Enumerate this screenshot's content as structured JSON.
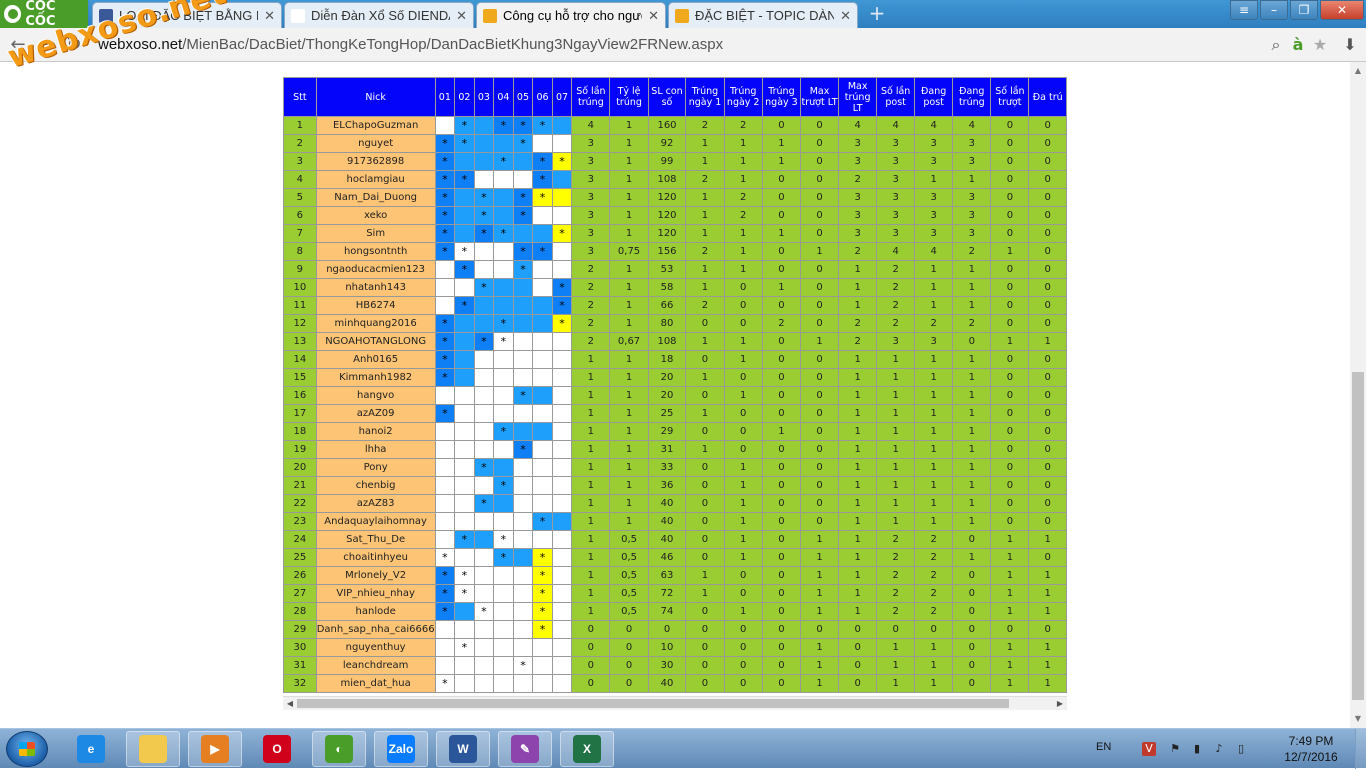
{
  "browser": {
    "brand": "CỐC CỐC",
    "tabs": [
      {
        "title": "LOẠI ĐẶC BIỆT BẰNG NGÀ",
        "icon": "facebook-icon",
        "color": "#3b5998"
      },
      {
        "title": "Diễn Đàn Xổ Số DIENDAN",
        "icon": "page-icon",
        "color": "#ffffff"
      },
      {
        "title": "Công cụ hỗ trợ cho người",
        "icon": "xs-icon",
        "color": "#f0a81c"
      },
      {
        "title": "ĐẶC BIỆT - TOPIC DÀN Đ",
        "icon": "xs-icon",
        "color": "#f0a81c"
      }
    ],
    "active_tab": 2,
    "url_host": "webxoso.net",
    "url_path": "/MienBac/DacBiet/ThongKeTongHop/DanDacBietKhung3NgayView2FRNew.aspx",
    "watermark": "webxoso.net"
  },
  "table": {
    "headers": [
      "Stt",
      "Nick",
      "01",
      "02",
      "03",
      "04",
      "05",
      "06",
      "07",
      "Số lần trúng",
      "Tỷ lệ trúng",
      "SL con số",
      "Trúng ngày 1",
      "Trúng ngày 2",
      "Trúng ngày 3",
      "Max trượt LT",
      "Max trúng LT",
      "Số lần post",
      "Đang post",
      "Đang trúng",
      "Số lần trượt",
      "Đa trú"
    ],
    "rows": [
      {
        "stt": "1",
        "nick": "ELChapoGuzman",
        "d": "w:,M:*,M:,L:*,L:*,M:*,M:",
        "s": [
          "4",
          "1",
          "160",
          "2",
          "2",
          "0",
          "0",
          "4",
          "4",
          "4",
          "4",
          "0",
          "0"
        ]
      },
      {
        "stt": "2",
        "nick": "nguyet",
        "d": "L:*,M:*,M:,M:,M:*,w:,w:",
        "s": [
          "3",
          "1",
          "92",
          "1",
          "1",
          "1",
          "0",
          "3",
          "3",
          "3",
          "3",
          "0",
          "0"
        ]
      },
      {
        "stt": "3",
        "nick": "917362898",
        "d": "L:*,M:,M:,M:*,M:,L:*,Y:*",
        "s": [
          "3",
          "1",
          "99",
          "1",
          "1",
          "1",
          "0",
          "3",
          "3",
          "3",
          "3",
          "0",
          "0"
        ]
      },
      {
        "stt": "4",
        "nick": "hoclamgiau",
        "d": "L:*,L:*,w:,w:,w:,L:*,M:",
        "s": [
          "3",
          "1",
          "108",
          "2",
          "1",
          "0",
          "0",
          "2",
          "3",
          "1",
          "1",
          "0",
          "0"
        ]
      },
      {
        "stt": "5",
        "nick": "Nam_Dai_Duong",
        "d": "L:*,M:,M:*,M:,L:*,Y:*,Y:",
        "s": [
          "3",
          "1",
          "120",
          "1",
          "2",
          "0",
          "0",
          "3",
          "3",
          "3",
          "3",
          "0",
          "0"
        ]
      },
      {
        "stt": "6",
        "nick": "xeko",
        "d": "L:*,M:,M:*,M:,L:*,w:,w:",
        "s": [
          "3",
          "1",
          "120",
          "1",
          "2",
          "0",
          "0",
          "3",
          "3",
          "3",
          "3",
          "0",
          "0"
        ]
      },
      {
        "stt": "7",
        "nick": "Sim",
        "d": "L:*,M:,L:*,M:*,M:,M:,Y:*",
        "s": [
          "3",
          "1",
          "120",
          "1",
          "1",
          "1",
          "0",
          "3",
          "3",
          "3",
          "3",
          "0",
          "0"
        ]
      },
      {
        "stt": "8",
        "nick": "hongsontnth",
        "d": "L:*,w:*,w:,w:,L:*,L:*,w:",
        "s": [
          "3",
          "0,75",
          "156",
          "2",
          "1",
          "0",
          "1",
          "2",
          "4",
          "4",
          "2",
          "1",
          "0"
        ]
      },
      {
        "stt": "9",
        "nick": "ngaoducacmien123",
        "d": "w:,L:*,w:,w:,M:*,w:,w:",
        "s": [
          "2",
          "1",
          "53",
          "1",
          "1",
          "0",
          "0",
          "1",
          "2",
          "1",
          "1",
          "0",
          "0"
        ]
      },
      {
        "stt": "10",
        "nick": "nhatanh143",
        "d": "w:,w:,M:*,M:,M:,w:,L:*",
        "s": [
          "2",
          "1",
          "58",
          "1",
          "0",
          "1",
          "0",
          "1",
          "2",
          "1",
          "1",
          "0",
          "0"
        ]
      },
      {
        "stt": "11",
        "nick": "HB6274",
        "d": "w:,L:*,M:,M:,M:,M:,L:*",
        "s": [
          "2",
          "1",
          "66",
          "2",
          "0",
          "0",
          "0",
          "1",
          "2",
          "1",
          "1",
          "0",
          "0"
        ]
      },
      {
        "stt": "12",
        "nick": "minhquang2016",
        "d": "L:*,M:,M:,M:*,M:,M:,Y:*",
        "s": [
          "2",
          "1",
          "80",
          "0",
          "0",
          "2",
          "0",
          "2",
          "2",
          "2",
          "2",
          "0",
          "0"
        ]
      },
      {
        "stt": "13",
        "nick": "NGOAHOTANGLONG",
        "d": "L:*,M:,L:*,w:*,w:,w:,w:",
        "s": [
          "2",
          "0,67",
          "108",
          "1",
          "1",
          "0",
          "1",
          "2",
          "3",
          "3",
          "0",
          "1",
          "1"
        ]
      },
      {
        "stt": "14",
        "nick": "Anh0165",
        "d": "L:*,M:,w:,w:,w:,w:,w:",
        "s": [
          "1",
          "1",
          "18",
          "0",
          "1",
          "0",
          "0",
          "1",
          "1",
          "1",
          "1",
          "0",
          "0"
        ]
      },
      {
        "stt": "15",
        "nick": "Kimmanh1982",
        "d": "L:*,M:,w:,w:,w:,w:,w:",
        "s": [
          "1",
          "1",
          "20",
          "1",
          "0",
          "0",
          "0",
          "1",
          "1",
          "1",
          "1",
          "0",
          "0"
        ]
      },
      {
        "stt": "16",
        "nick": "hangvo",
        "d": "w:,w:,w:,w:,M:*,M:,w:",
        "s": [
          "1",
          "1",
          "20",
          "0",
          "1",
          "0",
          "0",
          "1",
          "1",
          "1",
          "1",
          "0",
          "0"
        ]
      },
      {
        "stt": "17",
        "nick": "azAZ09",
        "d": "L:*,w:,w:,w:,w:,w:,w:",
        "s": [
          "1",
          "1",
          "25",
          "1",
          "0",
          "0",
          "0",
          "1",
          "1",
          "1",
          "1",
          "0",
          "0"
        ]
      },
      {
        "stt": "18",
        "nick": "hanoi2",
        "d": "w:,w:,w:,M:*,M:,M:,w:",
        "s": [
          "1",
          "1",
          "29",
          "0",
          "0",
          "1",
          "0",
          "1",
          "1",
          "1",
          "1",
          "0",
          "0"
        ]
      },
      {
        "stt": "19",
        "nick": "lhha",
        "d": "w:,w:,w:,w:,L:*,w:,w:",
        "s": [
          "1",
          "1",
          "31",
          "1",
          "0",
          "0",
          "0",
          "1",
          "1",
          "1",
          "1",
          "0",
          "0"
        ]
      },
      {
        "stt": "20",
        "nick": "Pony",
        "d": "w:,w:,M:*,M:,w:,w:,w:",
        "s": [
          "1",
          "1",
          "33",
          "0",
          "1",
          "0",
          "0",
          "1",
          "1",
          "1",
          "1",
          "0",
          "0"
        ]
      },
      {
        "stt": "21",
        "nick": "chenbig",
        "d": "w:,w:,w:,M:*,w:,w:,w:",
        "s": [
          "1",
          "1",
          "36",
          "0",
          "1",
          "0",
          "0",
          "1",
          "1",
          "1",
          "1",
          "0",
          "0"
        ]
      },
      {
        "stt": "22",
        "nick": "azAZ83",
        "d": "w:,w:,M:*,M:,w:,w:,w:",
        "s": [
          "1",
          "1",
          "40",
          "0",
          "1",
          "0",
          "0",
          "1",
          "1",
          "1",
          "1",
          "0",
          "0"
        ]
      },
      {
        "stt": "23",
        "nick": "Andaquaylaihomnay",
        "d": "w:,w:,w:,w:,w:,M:*,M:",
        "s": [
          "1",
          "1",
          "40",
          "0",
          "1",
          "0",
          "0",
          "1",
          "1",
          "1",
          "1",
          "0",
          "0"
        ]
      },
      {
        "stt": "24",
        "nick": "Sat_Thu_De",
        "d": "w:,M:*,M:,w:*,w:,w:,w:",
        "s": [
          "1",
          "0,5",
          "40",
          "0",
          "1",
          "0",
          "1",
          "1",
          "2",
          "2",
          "0",
          "1",
          "1"
        ]
      },
      {
        "stt": "25",
        "nick": "choaitinhyeu",
        "d": "w:*,w:,w:,M:*,M:,Y:*,w:",
        "s": [
          "1",
          "0,5",
          "46",
          "0",
          "1",
          "0",
          "1",
          "1",
          "2",
          "2",
          "1",
          "1",
          "0"
        ]
      },
      {
        "stt": "26",
        "nick": "Mrlonely_V2",
        "d": "L:*,w:*,w:,w:,w:,Y:*,w:",
        "s": [
          "1",
          "0,5",
          "63",
          "1",
          "0",
          "0",
          "1",
          "1",
          "2",
          "2",
          "0",
          "1",
          "1"
        ]
      },
      {
        "stt": "27",
        "nick": "VIP_nhieu_nhay",
        "d": "L:*,w:*,w:,w:,w:,Y:*,w:",
        "s": [
          "1",
          "0,5",
          "72",
          "1",
          "0",
          "0",
          "1",
          "1",
          "2",
          "2",
          "0",
          "1",
          "1"
        ]
      },
      {
        "stt": "28",
        "nick": "hanlode",
        "d": "L:*,M:,w:*,w:,w:,Y:*,w:",
        "s": [
          "1",
          "0,5",
          "74",
          "0",
          "1",
          "0",
          "1",
          "1",
          "2",
          "2",
          "0",
          "1",
          "1"
        ]
      },
      {
        "stt": "29",
        "nick": "Danh_sap_nha_cai6666",
        "d": "w:,w:,w:,w:,w:,Y:*,w:",
        "s": [
          "0",
          "0",
          "0",
          "0",
          "0",
          "0",
          "0",
          "0",
          "0",
          "0",
          "0",
          "0",
          "0"
        ]
      },
      {
        "stt": "30",
        "nick": "nguyenthuy",
        "d": "w:,w:*,w:,w:,w:,w:,w:",
        "s": [
          "0",
          "0",
          "10",
          "0",
          "0",
          "0",
          "1",
          "0",
          "1",
          "1",
          "0",
          "1",
          "1"
        ]
      },
      {
        "stt": "31",
        "nick": "leanchdream",
        "d": "w:,w:,w:,w:,w:*,w:,w:",
        "s": [
          "0",
          "0",
          "30",
          "0",
          "0",
          "0",
          "1",
          "0",
          "1",
          "1",
          "0",
          "1",
          "1"
        ]
      },
      {
        "stt": "32",
        "nick": "mien_dat_hua",
        "d": "w:*,w:,w:,w:,w:,w:,w:",
        "s": [
          "0",
          "0",
          "40",
          "0",
          "0",
          "0",
          "1",
          "0",
          "1",
          "1",
          "0",
          "1",
          "1"
        ]
      }
    ]
  },
  "colors": {
    "header_bg": "#0404fb",
    "stt_bg": "#9acd32",
    "nick_bg": "#fcc474",
    "dark_blue": "#0e7ff5",
    "mid_blue": "#1f9ffc",
    "yellow": "#ffff00"
  },
  "taskbar": {
    "apps": [
      {
        "name": "internet-explorer-icon",
        "label": "e",
        "color": "#1e88e5",
        "open": false
      },
      {
        "name": "file-explorer-icon",
        "label": "",
        "color": "#f2c94c",
        "open": true
      },
      {
        "name": "media-player-icon",
        "label": "▶",
        "color": "#e67e22",
        "open": true
      },
      {
        "name": "opera-icon",
        "label": "O",
        "color": "#d0021b",
        "open": false
      },
      {
        "name": "coccoc-icon",
        "label": "◐",
        "color": "#4b9d2a",
        "open": true
      },
      {
        "name": "zalo-icon",
        "label": "Zalo",
        "color": "#0a7cff",
        "open": true
      },
      {
        "name": "word-icon",
        "label": "W",
        "color": "#2b579a",
        "open": true
      },
      {
        "name": "paint-icon",
        "label": "✎",
        "color": "#8e44ad",
        "open": true
      },
      {
        "name": "excel-icon",
        "label": "X",
        "color": "#217346",
        "open": true
      }
    ],
    "lang": "EN",
    "time": "7:49 PM",
    "date": "12/7/2016"
  }
}
